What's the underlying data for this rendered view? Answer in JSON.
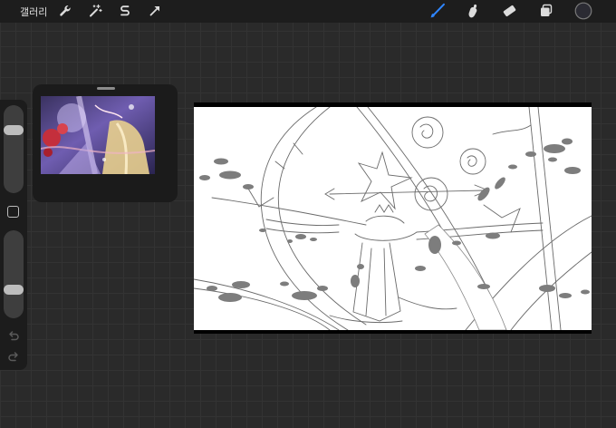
{
  "topbar": {
    "gallery_label": "갤러리",
    "tools_left": [
      "wrench-icon",
      "magic-wand-icon",
      "selection-icon",
      "transform-arrow-icon"
    ],
    "tools_right": [
      "brush-icon",
      "smudge-icon",
      "eraser-icon",
      "layers-icon",
      "color-swatch"
    ],
    "active_tool": "brush-icon",
    "accent_color": "#2f86ff",
    "current_color": "#2b2b33"
  },
  "sidebar": {
    "brush_size_level": 0.75,
    "opacity_level": 0.3,
    "buttons": [
      "modify-button",
      "undo-icon",
      "redo-icon"
    ]
  },
  "reference": {
    "palette": [
      "#3a3260",
      "#6f5db0",
      "#c42f3c",
      "#e8cf8e",
      "#b7a6e4"
    ]
  }
}
